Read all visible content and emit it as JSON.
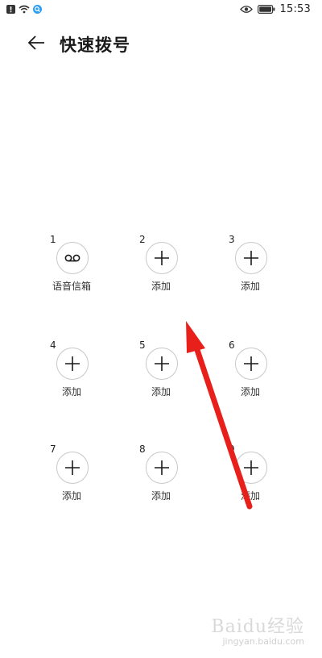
{
  "status_bar": {
    "time": "15:53"
  },
  "header": {
    "title": "快速拨号"
  },
  "slots": [
    {
      "number": "1",
      "label": "语音信箱",
      "icon": "voicemail-icon"
    },
    {
      "number": "2",
      "label": "添加",
      "icon": "plus-icon"
    },
    {
      "number": "3",
      "label": "添加",
      "icon": "plus-icon"
    },
    {
      "number": "4",
      "label": "添加",
      "icon": "plus-icon"
    },
    {
      "number": "5",
      "label": "添加",
      "icon": "plus-icon"
    },
    {
      "number": "6",
      "label": "添加",
      "icon": "plus-icon"
    },
    {
      "number": "7",
      "label": "添加",
      "icon": "plus-icon"
    },
    {
      "number": "8",
      "label": "添加",
      "icon": "plus-icon"
    },
    {
      "number": "9",
      "label": "添加",
      "icon": "plus-icon"
    }
  ],
  "watermark": {
    "brand": "Baidu经验",
    "sub": "jingyan.baidu.com"
  },
  "colors": {
    "annotation_arrow": "#e8201c",
    "circle_border": "#c8c8c8"
  }
}
